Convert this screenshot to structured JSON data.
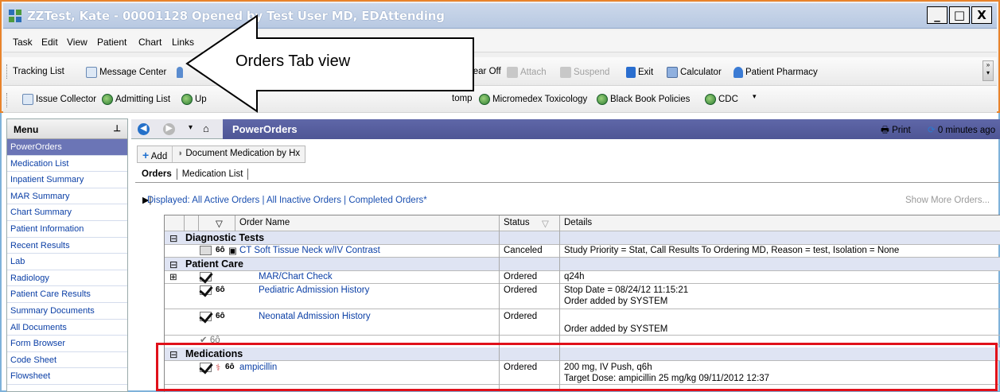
{
  "window": {
    "title": "ZZTest, Kate - 00001128 Opened by Test User MD, EDAttending",
    "controls": [
      "_",
      "□",
      "X"
    ]
  },
  "menubar": [
    "Task",
    "Edit",
    "View",
    "Patient",
    "Chart",
    "Links"
  ],
  "toolbar1": {
    "tracking_list": "Tracking List",
    "message_center": "Message Center",
    "tear_off": "Tear Off",
    "attach": "Attach",
    "suspend": "Suspend",
    "exit": "Exit",
    "calculator": "Calculator",
    "patient_pharmacy": "Patient Pharmacy"
  },
  "toolbar2": {
    "issue_collector": "Issue Collector",
    "admitting_list": "Admitting List",
    "up_prefix": "Up",
    "tomp": "tomp",
    "micromedex": "Micromedex Toxicology",
    "black_book": "Black Book Policies",
    "cdc": "CDC"
  },
  "callout": {
    "label": "Orders Tab view"
  },
  "menu": {
    "header": "Menu",
    "pin": "ᵖ",
    "items": [
      "PowerOrders",
      "Medication List",
      "Inpatient Summary",
      "MAR Summary",
      "Chart Summary",
      "Patient Information",
      "Recent Results",
      "Lab",
      "Radiology",
      "Patient Care Results",
      "Summary Documents",
      "All Documents",
      "Form Browser",
      "Code Sheet",
      "Flowsheet"
    ],
    "active_index": 0
  },
  "powerorders": {
    "title": "PowerOrders",
    "print": "Print",
    "refresh": "0 minutes ago"
  },
  "actions": {
    "add": "Add",
    "document_med": "Document Medication by Hx"
  },
  "tabs": {
    "orders": "Orders",
    "medication_list": "Medication List"
  },
  "filter": {
    "displayed": "Displayed: All Active Orders | All Inactive Orders | Completed Orders*",
    "show_more": "Show More Orders..."
  },
  "grid": {
    "headers": {
      "order_name": "Order Name",
      "status": "Status",
      "details": "Details"
    },
    "sections": {
      "diagnostic": "Diagnostic Tests",
      "patient_care": "Patient Care",
      "medications": "Medications"
    },
    "rows": {
      "ct": {
        "name": "CT Soft Tissue Neck w/IV Contrast",
        "status": "Canceled",
        "details": "Study Priority = Stat, Call Results To Ordering MD, Reason = test, Isolation = None"
      },
      "mar": {
        "name": "MAR/Chart Check",
        "status": "Ordered",
        "details": "q24h"
      },
      "peds": {
        "name": "Pediatric Admission History",
        "status": "Ordered",
        "details": "Stop Date = 08/24/12 11:15:21",
        "details2": "Order added by SYSTEM"
      },
      "neo": {
        "name": "Neonatal Admission History",
        "status": "Ordered",
        "details2": "Order added by SYSTEM"
      },
      "amp": {
        "name": "ampicillin",
        "status": "Ordered",
        "details": "200 mg, IV Push, q6h",
        "details2": "Target Dose: ampicillin 25 mg/kg  09/11/2012 12:37"
      }
    }
  },
  "colors": {
    "window_border": "#e8832a",
    "highlight": "#e0101a",
    "header_bar": "#5f67a8",
    "link": "#0b3fa6"
  }
}
